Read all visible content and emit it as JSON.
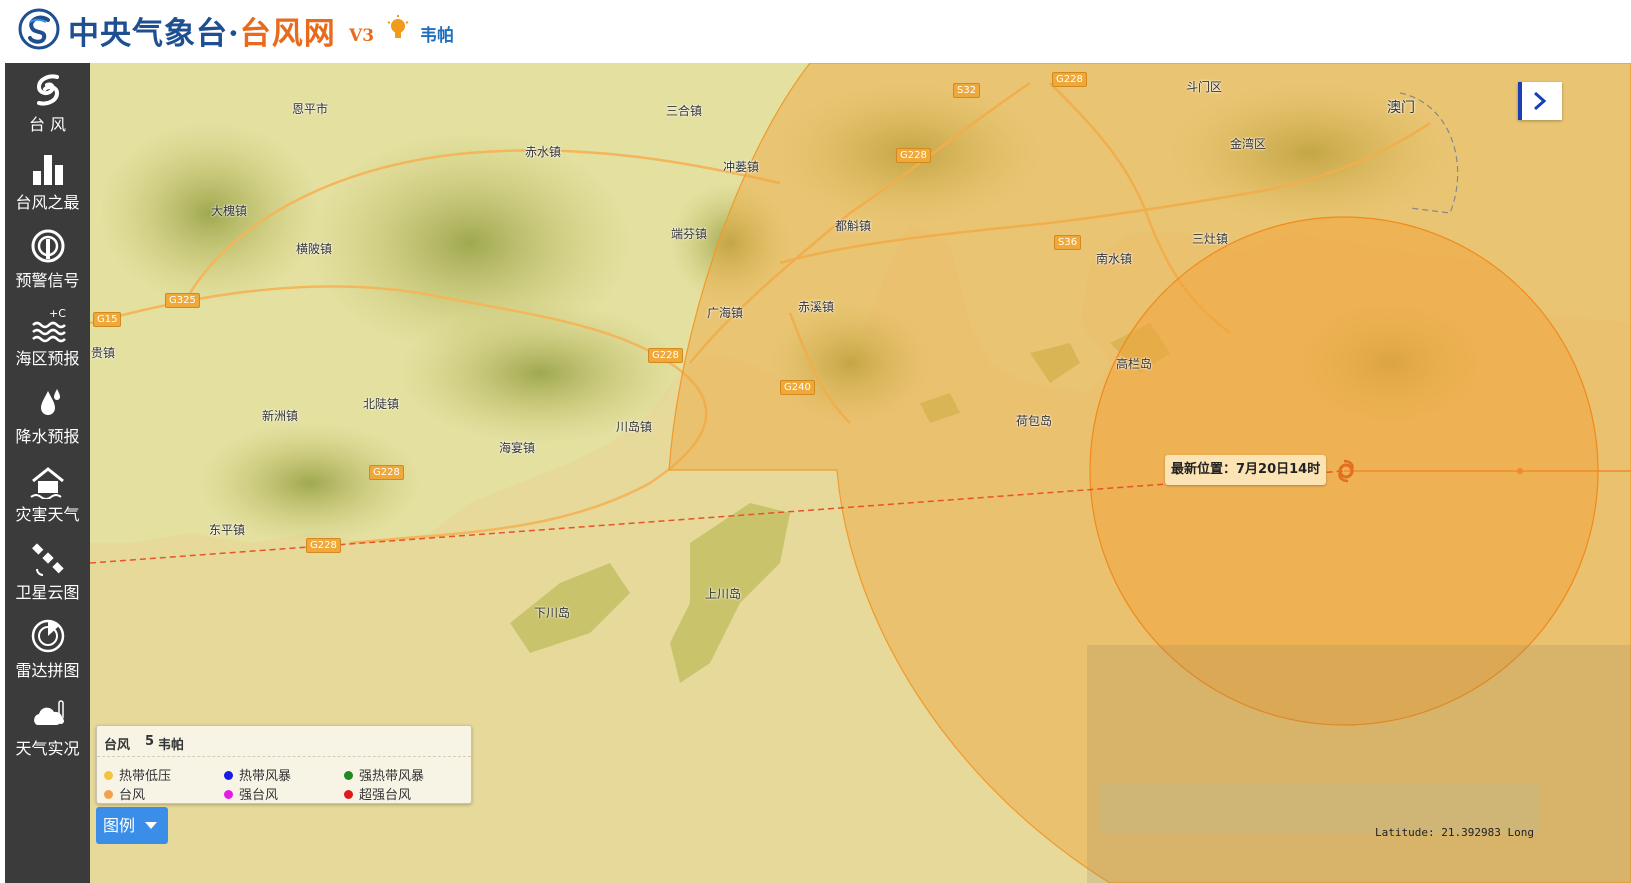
{
  "header": {
    "title_main": "中央气象台·",
    "title_accent": "台风网",
    "version": "V3",
    "typhoon_link": "韦帕"
  },
  "sidebar": {
    "items": [
      {
        "label": "台 风",
        "icon": "typhoon-icon"
      },
      {
        "label": "台风之最",
        "icon": "bar-chart-icon"
      },
      {
        "label": "预警信号",
        "icon": "warning-signal-icon"
      },
      {
        "label": "海区预报",
        "icon": "sea-forecast-icon"
      },
      {
        "label": "降水预报",
        "icon": "rain-drop-icon"
      },
      {
        "label": "灾害天气",
        "icon": "disaster-house-icon"
      },
      {
        "label": "卫星云图",
        "icon": "satellite-icon"
      },
      {
        "label": "雷达拼图",
        "icon": "radar-icon"
      },
      {
        "label": "天气实况",
        "icon": "weather-observation-icon"
      }
    ]
  },
  "map": {
    "places": [
      {
        "name": "恩平市"
      },
      {
        "name": "三合镇"
      },
      {
        "name": "赤水镇"
      },
      {
        "name": "大槐镇"
      },
      {
        "name": "横陂镇"
      },
      {
        "name": "冲蒌镇"
      },
      {
        "name": "端芬镇"
      },
      {
        "name": "都斛镇"
      },
      {
        "name": "广海镇"
      },
      {
        "name": "赤溪镇"
      },
      {
        "name": "北陡镇"
      },
      {
        "name": "新洲镇"
      },
      {
        "name": "海宴镇"
      },
      {
        "name": "川岛镇"
      },
      {
        "name": "东平镇"
      },
      {
        "name": "上川岛"
      },
      {
        "name": "下川岛"
      },
      {
        "name": "斗门区"
      },
      {
        "name": "澳门"
      },
      {
        "name": "金湾区"
      },
      {
        "name": "三灶镇"
      },
      {
        "name": "南水镇"
      },
      {
        "name": "高栏岛"
      },
      {
        "name": "荷包岛"
      },
      {
        "name": "镇"
      },
      {
        "name": "贵镇"
      }
    ],
    "roads": [
      {
        "name": "G325"
      },
      {
        "name": "G15"
      },
      {
        "name": "G228"
      },
      {
        "name": "G228"
      },
      {
        "name": "G228"
      },
      {
        "name": "G240"
      },
      {
        "name": "S32"
      },
      {
        "name": "G228"
      },
      {
        "name": "G228"
      },
      {
        "name": "S36"
      }
    ],
    "latest_position": "最新位置：7月20日14时",
    "coordinates_readout": "Latitude: 21.392983 Long"
  },
  "legend": {
    "category": "台风",
    "number": "5",
    "name": "韦帕",
    "items": [
      {
        "label": "热带低压",
        "color": "#f2c53d"
      },
      {
        "label": "热带风暴",
        "color": "#1a1ae6"
      },
      {
        "label": "强热带风暴",
        "color": "#1f8a1f"
      },
      {
        "label": "台风",
        "color": "#f5a04a"
      },
      {
        "label": "强台风",
        "color": "#e61ae6"
      },
      {
        "label": "超强台风",
        "color": "#e01a1a"
      }
    ],
    "toggle_label": "图例"
  },
  "colors": {
    "sidebar_bg": "#3b3b3b",
    "brand_blue": "#1d4f91",
    "brand_orange": "#e86b1d",
    "wind_circle": "#f0a43c",
    "track_line": "#e8542a"
  }
}
